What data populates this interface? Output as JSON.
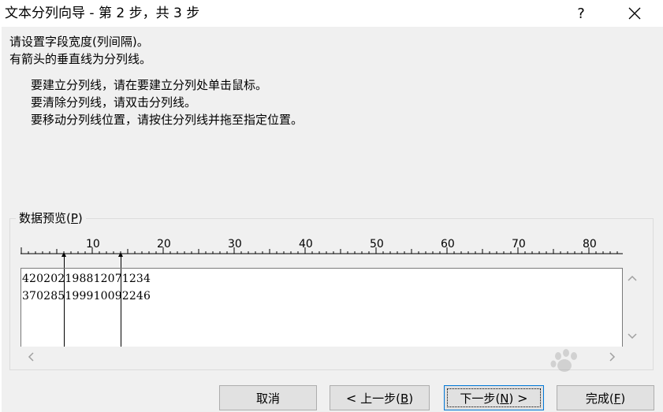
{
  "window": {
    "title": "文本分列向导 - 第 2 步，共 3 步",
    "help_label": "?",
    "close_icon": "close-icon"
  },
  "instructions": {
    "line1": "请设置字段宽度(列间隔)。",
    "line2": "有箭头的垂直线为分列线。",
    "step1": "要建立分列线，请在要建立分列处单击鼠标。",
    "step2": "要清除分列线，请双击分列线。",
    "step3": "要移动分列线位置，请按住分列线并拖至指定位置。"
  },
  "preview": {
    "label": "数据预览",
    "label_key_open": "(",
    "label_key": "P",
    "label_key_close": ")",
    "ruler_marks": [
      "10",
      "20",
      "30",
      "40",
      "50",
      "60",
      "70",
      "80"
    ],
    "rows": [
      "420202198812071234",
      "370285199910092246"
    ],
    "column_breaks": [
      6,
      14
    ]
  },
  "buttons": {
    "cancel": "取消",
    "back_arrow": "<",
    "back": "上一步",
    "back_key_open": "(",
    "back_key": "B",
    "back_key_close": ")",
    "next": "下一步",
    "next_key_open": "(",
    "next_key": "N",
    "next_key_close": ")",
    "next_arrow": ">",
    "finish": "完成",
    "finish_key_open": "(",
    "finish_key": "F",
    "finish_key_close": ")"
  },
  "colors": {
    "focus_border": "#0078d7",
    "button_bg": "#e1e1e1",
    "dialog_bg": "#f0f0f0"
  }
}
